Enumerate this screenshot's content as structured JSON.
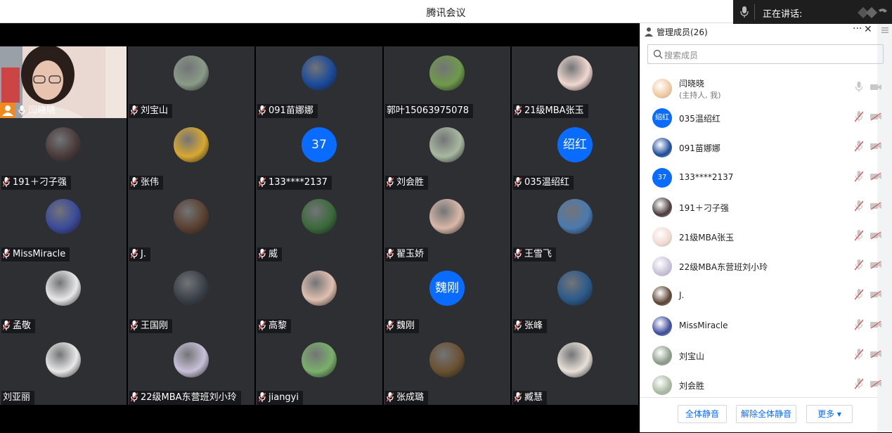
{
  "window": {
    "title": "腾讯会议"
  },
  "speaking": {
    "label": "正在讲话:"
  },
  "self_tile": {
    "name": "闫晓晓"
  },
  "tiles": [
    {
      "name": "刘宝山",
      "avatar": "photo",
      "color": "#8a9a88"
    },
    {
      "name": "091苗娜娜",
      "avatar": "photo",
      "color": "#1a4a9a"
    },
    {
      "name": "郭叶15063975078",
      "avatar": "photo",
      "color": "#6f9a4a",
      "nomic": true
    },
    {
      "name": "21级MBA张玉",
      "avatar": "photo",
      "color": "#f0d8d0"
    },
    {
      "name": "191＋刁子强",
      "avatar": "photo",
      "color": "#4a3a3a"
    },
    {
      "name": "张伟",
      "avatar": "photo",
      "color": "#d8a830"
    },
    {
      "name": "133****2137",
      "avatar": "text",
      "text": "37"
    },
    {
      "name": "刘会胜",
      "avatar": "photo",
      "color": "#a8b8a0"
    },
    {
      "name": "035温绍红",
      "avatar": "text",
      "text": "绍红"
    },
    {
      "name": "MissMiracle",
      "avatar": "photo",
      "color": "#3a4a9a"
    },
    {
      "name": "J.",
      "avatar": "photo",
      "color": "#5a4030"
    },
    {
      "name": "威",
      "avatar": "photo",
      "color": "#3a6a3a"
    },
    {
      "name": "翟玉娇",
      "avatar": "photo",
      "color": "#d8b8a8"
    },
    {
      "name": "王雪飞",
      "avatar": "photo",
      "color": "#4a7ab0"
    },
    {
      "name": "孟敬",
      "avatar": "photo",
      "color": "#e8e8e8"
    },
    {
      "name": "王国刚",
      "avatar": "photo",
      "color": "#3a4048"
    },
    {
      "name": "高黎",
      "avatar": "photo",
      "color": "#e0c0b0"
    },
    {
      "name": "魏刚",
      "avatar": "text",
      "text": "魏刚"
    },
    {
      "name": "张峰",
      "avatar": "photo",
      "color": "#2a5a8a"
    },
    {
      "name": "刘亚丽",
      "avatar": "photo",
      "color": "#e8e8e8",
      "nomic": true
    },
    {
      "name": "22级MBA东营班刘小玲",
      "avatar": "photo",
      "color": "#c8c0d8"
    },
    {
      "name": "jiangyi",
      "avatar": "photo",
      "color": "#7ab06a"
    },
    {
      "name": "张成璐",
      "avatar": "photo",
      "color": "#6a5030"
    },
    {
      "name": "臧慧",
      "avatar": "photo",
      "color": "#e8e0d8"
    }
  ],
  "panel": {
    "title": "管理成员(26)",
    "more": "···",
    "close": "✕",
    "search_placeholder": "搜索成员",
    "members": [
      {
        "name": "闫晓晓",
        "sub": "(主持人, 我)",
        "color": "#f0c8a0",
        "self": true
      },
      {
        "name": "035温绍红",
        "avatar_text": "绍红",
        "color": "#0a6cff"
      },
      {
        "name": "091苗娜娜",
        "color": "#1a4a9a"
      },
      {
        "name": "133****2137",
        "avatar_text": "37",
        "color": "#0a6cff"
      },
      {
        "name": "191＋刁子强",
        "color": "#4a3a3a"
      },
      {
        "name": "21级MBA张玉",
        "color": "#f0d8d0"
      },
      {
        "name": "22级MBA东营班刘小玲",
        "color": "#c8c0d8"
      },
      {
        "name": "J.",
        "color": "#5a4030"
      },
      {
        "name": "MissMiracle",
        "color": "#3a4a9a"
      },
      {
        "name": "刘宝山",
        "color": "#8a9a88"
      },
      {
        "name": "刘会胜",
        "color": "#a8b8a0"
      }
    ],
    "footer": {
      "mute_all": "全体静音",
      "unmute_all": "解除全体静音",
      "more": "更多 ▾"
    }
  },
  "colors": {
    "accent": "#0a6cff",
    "host_badge": "#f08a1c",
    "muted": "#e05555"
  }
}
